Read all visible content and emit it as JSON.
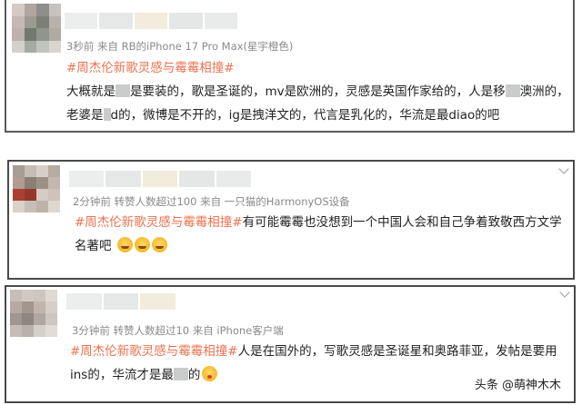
{
  "comments": [
    {
      "meta": "3秒前  来自 RB的iPhone 17 Pro Max(星宇橙色)",
      "hashtag": "#周杰伦新歌灵感与霉霉相撞#",
      "text_a": "大概就是",
      "text_b": "是要装的，歌是圣诞的，mv是欧洲的，灵感是英国作家给的，人是移",
      "text_c": "澳洲的，老婆是",
      "text_d": "d的，微博是不开的，ig是拽洋文的，代言是乳化的，华流是最diao的吧",
      "avatar_colors": [
        "#d9c9c4",
        "#b4a49e",
        "#8e8f8b",
        "#c7c2bb",
        "#c9b8b4",
        "#9e9a8f",
        "#7d8076",
        "#b8b2a8",
        "#bfb1ad",
        "#6f7a6c",
        "#8f9688",
        "#b0aaa0",
        "#d5d0ca",
        "#a5aba0",
        "#c0c4bc",
        "#dad6d0"
      ]
    },
    {
      "meta": "2分钟前  转赞人数超过100  来自 一只猫的HarmonyOS设备",
      "hashtag": "#周杰伦新歌灵感与霉霉相撞#",
      "text": "有可能霉霉也没想到一个中国人会和自己争着致敬西方文学名著吧",
      "avatar_colors": [
        "#a89e92",
        "#c8beb2",
        "#d8d0c6",
        "#b8aca0",
        "#b79a8e",
        "#8e7d71",
        "#a08f82",
        "#c4b8ac",
        "#c0392b",
        "#a83226",
        "#d8ccc0",
        "#cfc3b6",
        "#d9d2c8",
        "#c9beb2",
        "#bfb3a6",
        "#e0d8ce"
      ]
    },
    {
      "meta": "3分钟前  转赞人数超过10  来自 iPhone客户端",
      "hashtag": "#周杰伦新歌灵感与霉霉相撞#",
      "text_a": "人是在国外的，写歌灵感是圣诞星和奥路菲亚，发帖是要用ins的，华流才是最",
      "text_b": "的",
      "avatar_colors": [
        "#c8bdb6",
        "#d4c9c2",
        "#cfc5be",
        "#e0d8d2",
        "#b9a89e",
        "#a4968c",
        "#c2b4aa",
        "#d8cec7",
        "#a2968e",
        "#8f8680",
        "#b3a79f",
        "#cfc6bf",
        "#c5bdb7",
        "#bab1aa",
        "#d6cfc9",
        "#e2dcd7"
      ]
    }
  ],
  "name_bar_colors": [
    "#eceeed",
    "#e6e8e7",
    "#f1ecdc",
    "#e4e7e6",
    "#e9ebea"
  ],
  "watermark": {
    "text": "头条 @萌神木木"
  },
  "colors": {
    "hashtag": "#eb7350",
    "meta": "#8a8a8a",
    "border": "#4a4a4a"
  }
}
